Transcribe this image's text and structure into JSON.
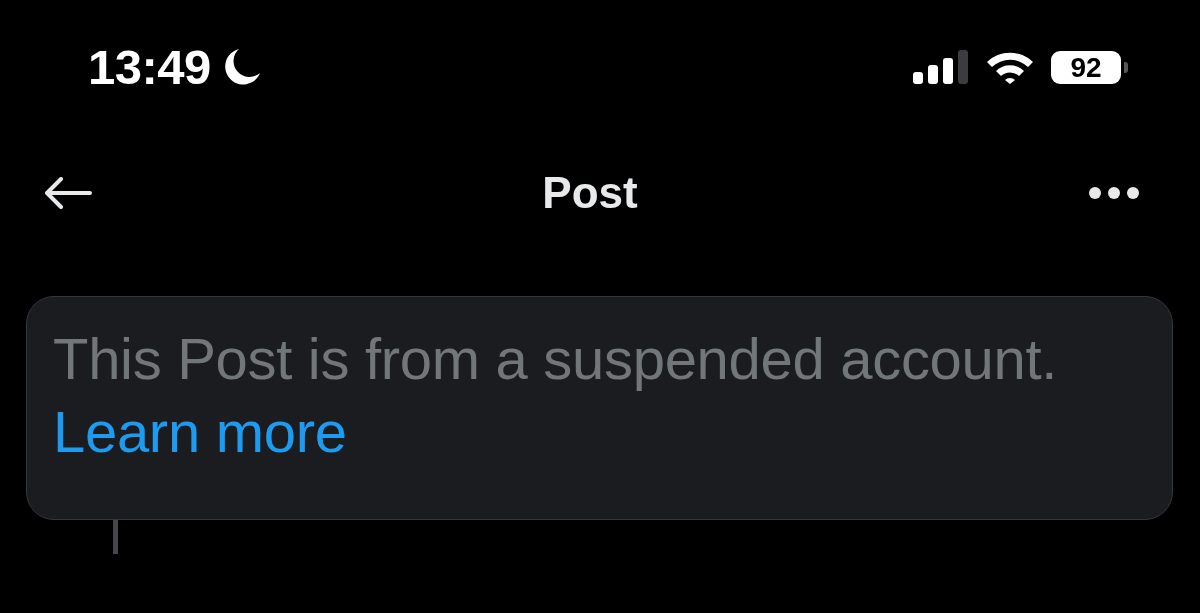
{
  "status_bar": {
    "time": "13:49",
    "battery": "92"
  },
  "header": {
    "title": "Post"
  },
  "notice": {
    "text": "This Post is from a suspended account.",
    "link": "Learn more"
  }
}
